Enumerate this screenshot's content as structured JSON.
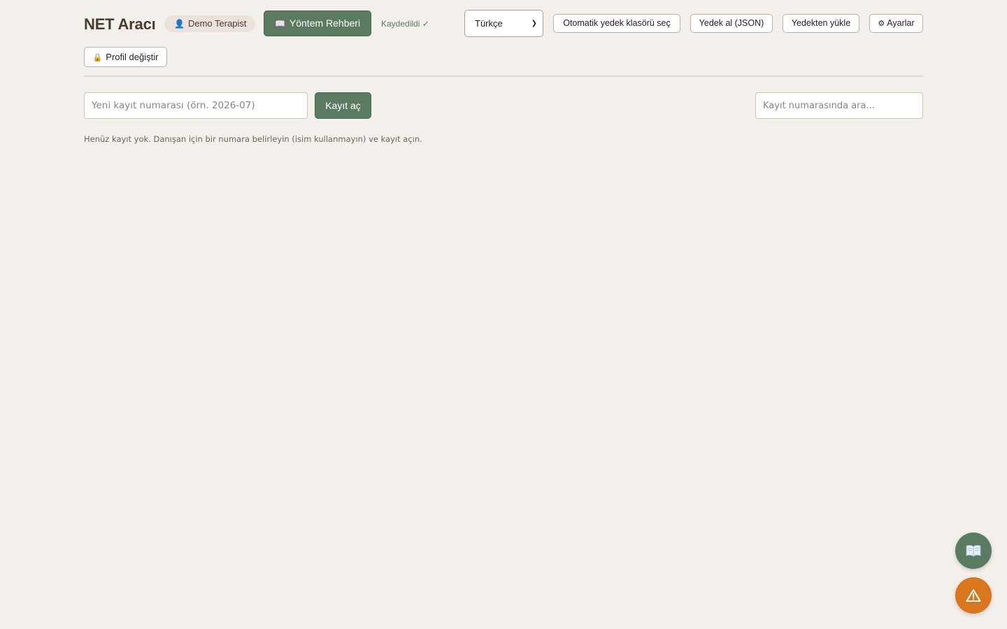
{
  "header": {
    "title": "NET Aracı",
    "user_name": "Demo Terapist",
    "user_icon": "person-icon",
    "guide_button": "Yöntem Rehberi",
    "guide_icon": "book-icon",
    "saved_status": "Kaydedildi ✓",
    "language": "Türkçe",
    "autobackup_button": "Otomatik yedek klasörü seç",
    "backup_button": "Yedek al (JSON)",
    "restore_button": "Yedekten yükle",
    "settings_button": "Ayarlar",
    "settings_icon": "gear-icon",
    "profile_button": "Profil değiştir",
    "profile_icon": "lock-icon"
  },
  "records": {
    "new_placeholder": "Yeni kayıt numarası (örn. 2026-07)",
    "open_button": "Kayıt aç",
    "search_placeholder": "Kayıt numarasında ara...",
    "empty_message": "Henüz kayıt yok. Danışan için bir numara belirleyin (isim kullanmayın) ve kayıt açın."
  },
  "fabs": {
    "guide_icon": "book-icon",
    "alert_icon": "warning-icon"
  },
  "colors": {
    "background": "#f3f0eb",
    "primary_green": "#5a7a62",
    "alert_orange": "#d9771c",
    "title_brown": "#4a3a30"
  }
}
